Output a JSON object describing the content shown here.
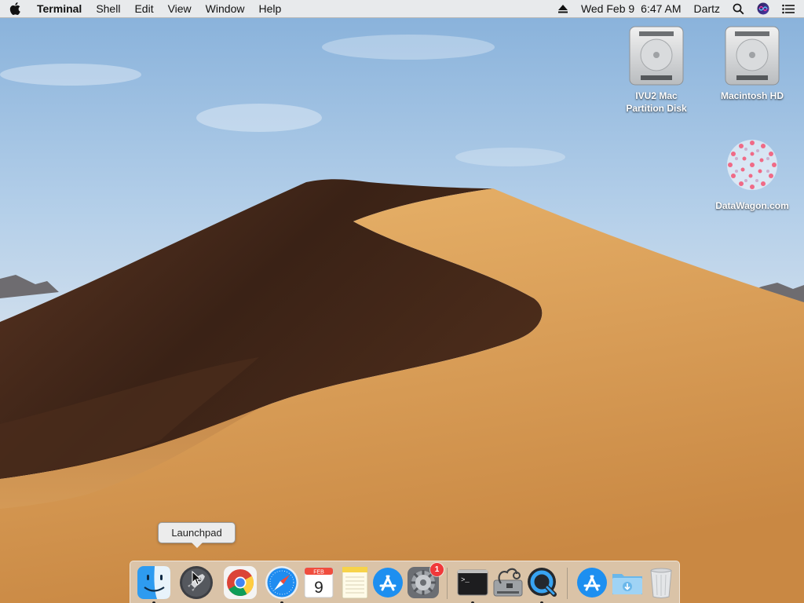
{
  "menubar": {
    "app_name": "Terminal",
    "menus": [
      "Shell",
      "Edit",
      "View",
      "Window",
      "Help"
    ],
    "date": "Wed Feb 9",
    "time": "6:47 AM",
    "user": "Dartz"
  },
  "desktop": {
    "icons": [
      {
        "label": "IVU2 Mac\nPartition Disk",
        "icon": "hard-drive-icon"
      },
      {
        "label": "Macintosh HD",
        "icon": "hard-drive-icon"
      },
      {
        "label": "DataWagon.com",
        "icon": "datawagon-logo-icon"
      }
    ]
  },
  "tooltip": {
    "label": "Launchpad"
  },
  "dock": {
    "items": [
      {
        "name": "Finder",
        "icon": "finder-icon",
        "running": true
      },
      {
        "name": "Launchpad",
        "icon": "launchpad-icon",
        "running": false
      },
      {
        "name": "Google Chrome",
        "icon": "chrome-icon",
        "running": false
      },
      {
        "name": "Safari",
        "icon": "safari-icon",
        "running": true
      },
      {
        "name": "Calendar",
        "icon": "calendar-icon",
        "running": false,
        "month": "FEB",
        "day": "9"
      },
      {
        "name": "Notes",
        "icon": "notes-icon",
        "running": false
      },
      {
        "name": "App Store",
        "icon": "app-store-icon",
        "running": false
      },
      {
        "name": "System Preferences",
        "icon": "system-preferences-icon",
        "running": false,
        "badge": "1"
      },
      {
        "name": "Terminal",
        "icon": "terminal-icon",
        "running": true,
        "prompt": ">_"
      },
      {
        "name": "Disk Utility",
        "icon": "disk-utility-icon",
        "running": false
      },
      {
        "name": "QuickTime Player",
        "icon": "quicktime-icon",
        "running": true
      },
      {
        "name": "Applications",
        "icon": "applications-folder-icon",
        "running": false
      },
      {
        "name": "Downloads",
        "icon": "downloads-folder-icon",
        "running": false
      },
      {
        "name": "Trash",
        "icon": "trash-icon",
        "running": false
      }
    ]
  },
  "colors": {
    "sky": "#a9c8e6",
    "dune_light": "#d9a35c",
    "dune_shadow": "#3e2519",
    "badge": "#f0383a"
  }
}
